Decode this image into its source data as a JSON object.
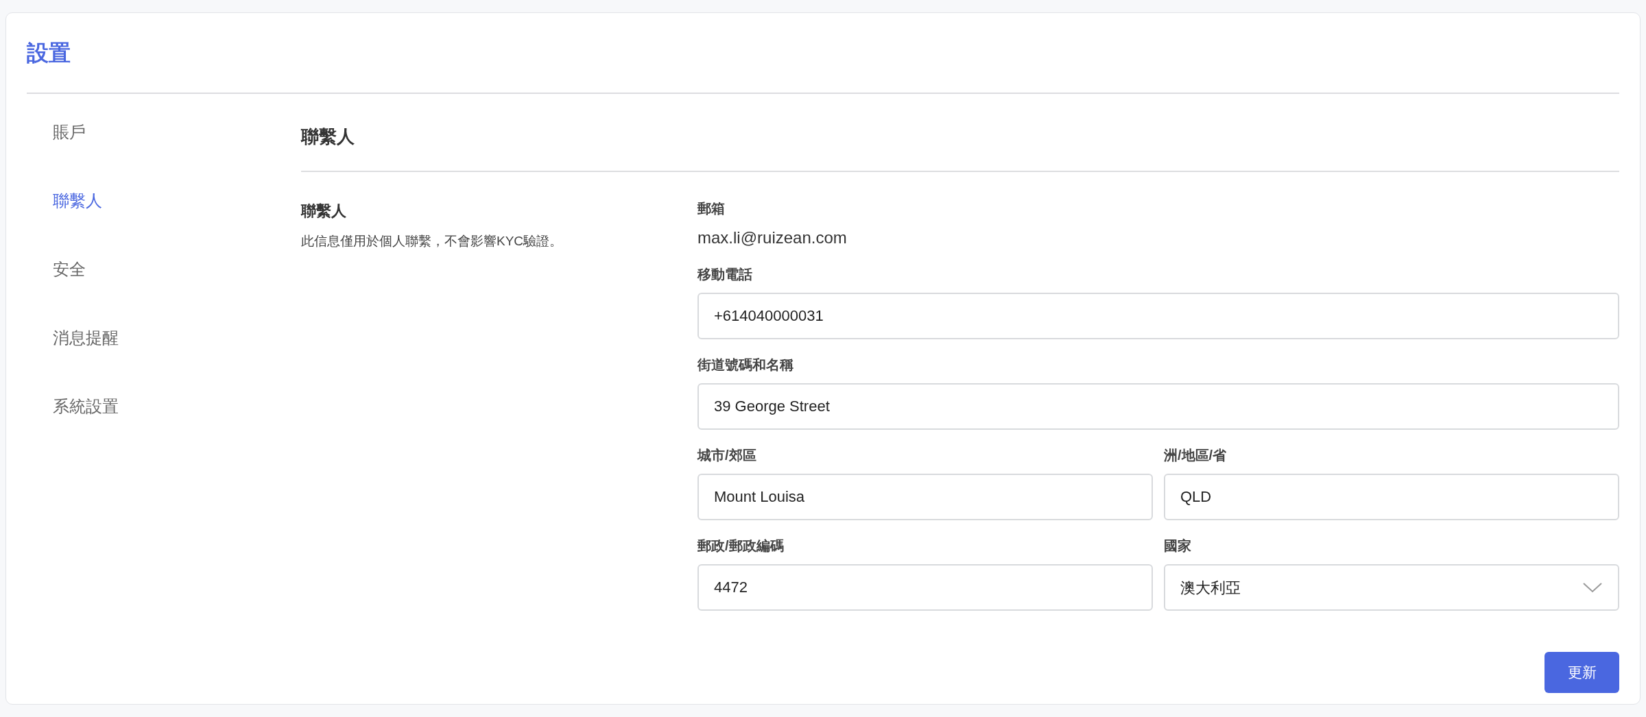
{
  "page": {
    "title": "設置"
  },
  "sidebar": {
    "items": [
      {
        "label": "賬戶",
        "selected": false
      },
      {
        "label": "聯繫人",
        "selected": true
      },
      {
        "label": "安全",
        "selected": false
      },
      {
        "label": "消息提醒",
        "selected": false
      },
      {
        "label": "系統設置",
        "selected": false
      }
    ]
  },
  "section": {
    "heading": "聯繫人",
    "subheading": "聯繫人",
    "description": "此信息僅用於個人聯繫，不會影響KYC驗證。"
  },
  "form": {
    "rows": [
      [
        {
          "kind": "static",
          "label": "郵箱",
          "value": "max.li@ruizean.com"
        }
      ],
      [
        {
          "kind": "input",
          "label": "移動電話",
          "value": "+614040000031"
        }
      ],
      [
        {
          "kind": "input",
          "label": "街道號碼和名稱",
          "value": "39 George Street"
        }
      ],
      [
        {
          "kind": "input",
          "label": "城市/郊區",
          "value": "Mount Louisa"
        },
        {
          "kind": "input",
          "label": "洲/地區/省",
          "value": "QLD"
        }
      ],
      [
        {
          "kind": "input",
          "label": "郵政/郵政編碼",
          "value": "4472"
        },
        {
          "kind": "select",
          "label": "國家",
          "value": "澳大利亞"
        }
      ]
    ]
  },
  "buttons": [
    {
      "label": "更新"
    }
  ]
}
